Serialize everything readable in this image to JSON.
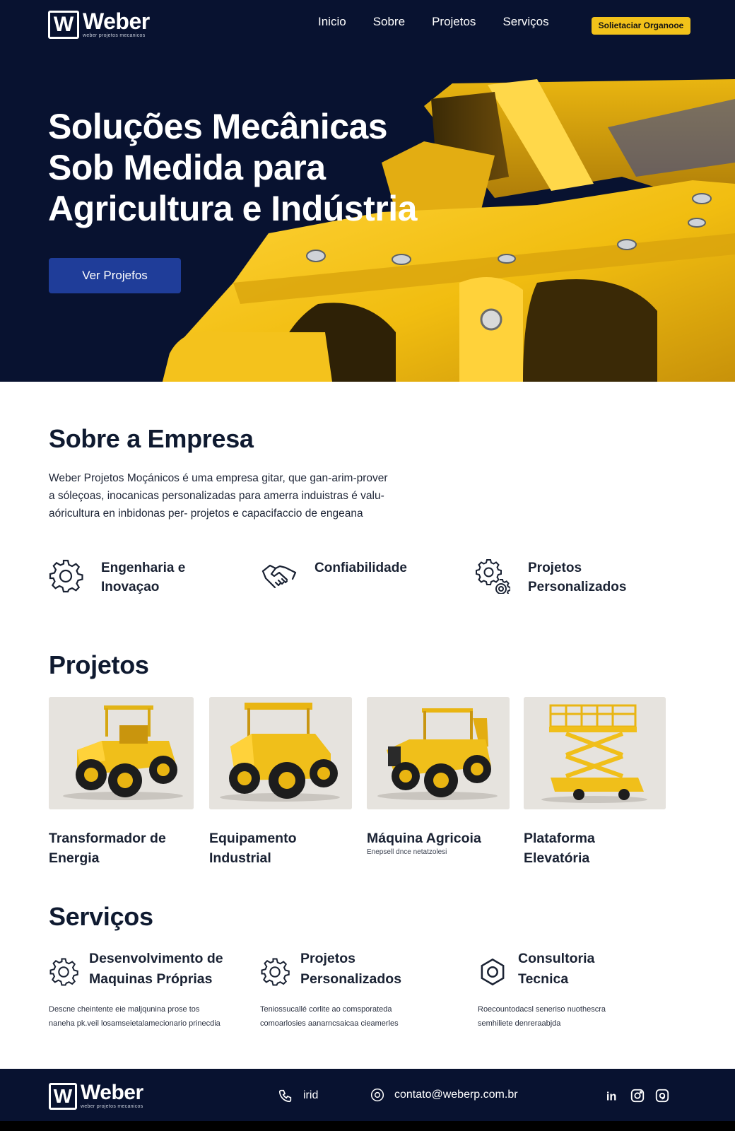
{
  "brand": {
    "logo_letter": "W",
    "name": "Weber",
    "tagline": "weber projetos mecanicos"
  },
  "nav": {
    "items": [
      "Inicio",
      "Sobre",
      "Projetos",
      "Serviços"
    ],
    "cta": "Solietaciar Organooe"
  },
  "hero": {
    "title_lines": [
      "Soluções Mecânicas",
      "Sob Medida para",
      "Agricultura e Indústria"
    ],
    "button": "Ver Projefos"
  },
  "about": {
    "heading": "Sobre a Empresa",
    "text_lines": [
      "Weber Projetos Moçánicos é uma empresa gitar, que gan-arim-prover",
      "a sóleçoas, inocanicas personalizadas para amerra induistras é valu-",
      "aóricultura en inbidonas per- projetos e capacifaccio de engeana"
    ],
    "features": [
      {
        "icon": "gear-icon",
        "lines": [
          "Engenharia e",
          "Inovaçao"
        ]
      },
      {
        "icon": "handshake-icon",
        "lines": [
          "Confiabilidade"
        ]
      },
      {
        "icon": "gears-icon",
        "lines": [
          "Projetos",
          "Personalizados"
        ]
      }
    ]
  },
  "projects": {
    "heading": "Projetos",
    "items": [
      {
        "image": "tractor-image",
        "lines": [
          "Transformador de",
          "Energia"
        ],
        "note": ""
      },
      {
        "image": "industrial-equipment-image",
        "lines": [
          "Equipamento",
          "Industrial"
        ],
        "note": ""
      },
      {
        "image": "agricultural-machine-image",
        "lines": [
          "Máquina Agricoia"
        ],
        "note": "Enepsell dnce netatzolesi"
      },
      {
        "image": "lift-platform-image",
        "lines": [
          "Plataforma",
          "Elevatória"
        ],
        "note": ""
      }
    ]
  },
  "services": {
    "heading": "Serviços",
    "items": [
      {
        "icon": "gear-icon",
        "lines": [
          "Desenvolvimento de",
          "Maquinas Próprias"
        ],
        "desc": [
          "Descne cheintente eie maljqunina prose tos",
          "naneha pk.veil losamseietalamecionario prinecdia"
        ]
      },
      {
        "icon": "gear-icon",
        "lines": [
          "Projetos",
          "Personalizados"
        ],
        "desc": [
          "Teniossucallé corlite ao comsporateda",
          "comoarlosies aanarncsaicaa cieamerles"
        ]
      },
      {
        "icon": "hex-nut-icon",
        "lines": [
          "Consultoria",
          "Tecnica"
        ],
        "desc": [
          "Roecountodacsl seneriso nuothescra",
          "semhiliete denreraabjda"
        ]
      }
    ]
  },
  "footer": {
    "phone_label": "irid",
    "email": "contato@weberp.com.br",
    "social": [
      "linkedin-icon",
      "instagram-icon",
      "threads-icon"
    ]
  },
  "colors": {
    "navy": "#081230",
    "accent_yellow": "#f2c21a",
    "button_blue": "#1f3d99"
  }
}
